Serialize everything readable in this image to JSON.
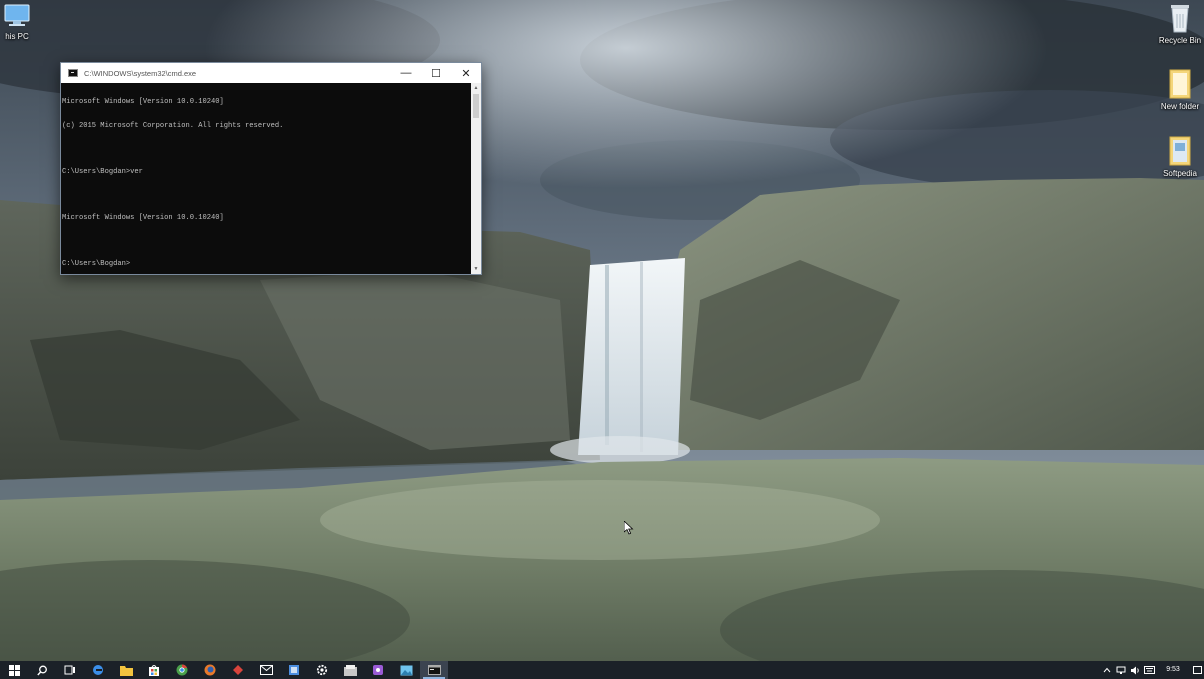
{
  "desktop": {
    "icons": [
      {
        "label": "his PC"
      },
      {
        "label": "Recycle Bin"
      },
      {
        "label": "New folder"
      },
      {
        "label": "Softpedia"
      }
    ]
  },
  "cmd_window": {
    "title": "C:\\WINDOWS\\system32\\cmd.exe",
    "lines": [
      "Microsoft Windows [Version 10.0.10240]",
      "(c) 2015 Microsoft Corporation. All rights reserved.",
      "",
      "C:\\Users\\Bogdan>ver",
      "",
      "Microsoft Windows [Version 10.0.10240]",
      "",
      "C:\\Users\\Bogdan>"
    ],
    "minimize_symbol": "—",
    "maximize_symbol": "☐",
    "close_symbol": "✕"
  },
  "taskbar": {
    "clock_time": "9:53",
    "items": [
      {
        "icon": "windows-logo-icon",
        "color": "#ffffff"
      },
      {
        "icon": "search-icon",
        "color": "#ffffff"
      },
      {
        "icon": "task-view-icon",
        "color": "#ffffff"
      },
      {
        "icon": "edge-icon",
        "color": "#3b8ee8"
      },
      {
        "icon": "file-explorer-icon",
        "color": "#f3c43f"
      },
      {
        "icon": "store-icon",
        "color": "#ffffff"
      },
      {
        "icon": "chrome-icon",
        "color": "#4aa04a"
      },
      {
        "icon": "firefox-icon",
        "color": "#e8792a"
      },
      {
        "icon": "app-red-icon",
        "color": "#d9443c"
      },
      {
        "icon": "mail-icon",
        "color": "#ffffff"
      },
      {
        "icon": "app-blue-icon",
        "color": "#4c8ee0"
      },
      {
        "icon": "settings-icon",
        "color": "#ffffff"
      },
      {
        "icon": "app-folder-icon",
        "color": "#c7c7c7"
      },
      {
        "icon": "app-purple-icon",
        "color": "#9b5bd6"
      },
      {
        "icon": "photos-icon",
        "color": "#6fc3ee"
      },
      {
        "icon": "cmd-icon",
        "color": "#111111"
      }
    ]
  }
}
